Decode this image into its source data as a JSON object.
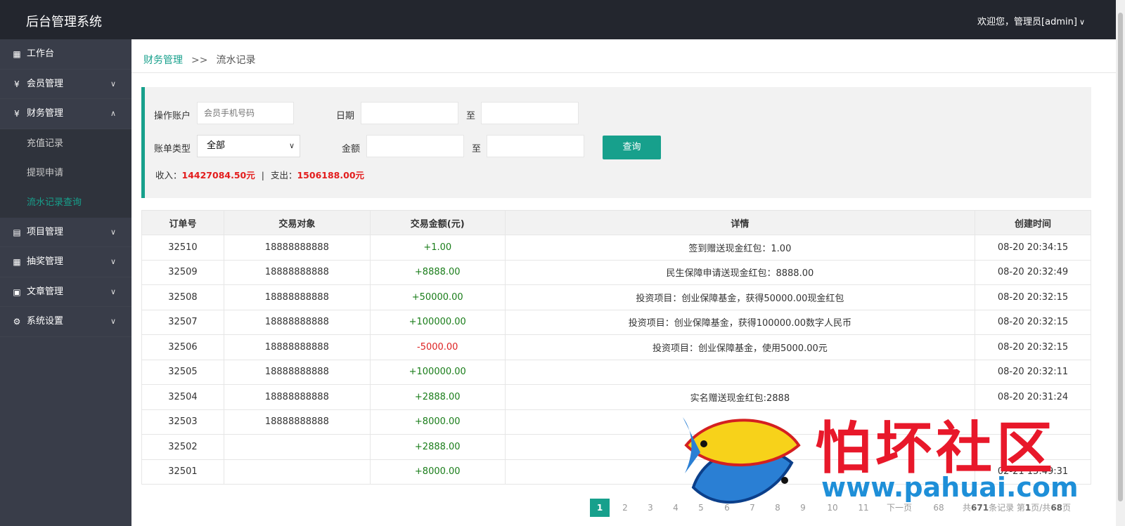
{
  "header": {
    "app_title": "后台管理系统",
    "user_greeting": "欢迎您，管理员[admin]"
  },
  "sidebar": {
    "items": [
      {
        "label": "工作台",
        "icon": "dashboard-icon",
        "expandable": false
      },
      {
        "label": "会员管理",
        "icon": "yen-circle-icon",
        "expandable": true,
        "expanded": false
      },
      {
        "label": "财务管理",
        "icon": "yen-circle-icon",
        "expandable": true,
        "expanded": true,
        "children": [
          {
            "label": "充值记录",
            "active": false
          },
          {
            "label": "提现申请",
            "active": false
          },
          {
            "label": "流水记录查询",
            "active": true
          }
        ]
      },
      {
        "label": "项目管理",
        "icon": "clipboard-icon",
        "expandable": true,
        "expanded": false
      },
      {
        "label": "抽奖管理",
        "icon": "dashboard-icon",
        "expandable": true,
        "expanded": false
      },
      {
        "label": "文章管理",
        "icon": "document-icon",
        "expandable": true,
        "expanded": false
      },
      {
        "label": "系统设置",
        "icon": "gear-icon",
        "expandable": true,
        "expanded": false
      }
    ]
  },
  "breadcrumb": {
    "parent": "财务管理",
    "separator": ">>",
    "current": "流水记录"
  },
  "filter": {
    "account_label": "操作账户",
    "account_placeholder": "会员手机号码",
    "date_label": "日期",
    "to_label": "至",
    "bill_type_label": "账单类型",
    "bill_type_value": "全部",
    "amount_label": "金额",
    "query_button": "查询",
    "income_label": "收入：",
    "income_value": "14427084.50元",
    "summary_separator": "|",
    "expense_label": "支出：",
    "expense_value": "1506188.00元"
  },
  "table": {
    "headers": [
      "订单号",
      "交易对象",
      "交易金额(元)",
      "详情",
      "创建时间"
    ],
    "rows": [
      {
        "id": "32510",
        "target": "18888888888",
        "amount": "+1.00",
        "detail": "签到赠送现金红包：1.00",
        "time": "08-20 20:34:15"
      },
      {
        "id": "32509",
        "target": "18888888888",
        "amount": "+8888.00",
        "detail": "民生保障申请送现金红包：8888.00",
        "time": "08-20 20:32:49"
      },
      {
        "id": "32508",
        "target": "18888888888",
        "amount": "+50000.00",
        "detail": "投资项目：创业保障基金，获得50000.00现金红包",
        "time": "08-20 20:32:15"
      },
      {
        "id": "32507",
        "target": "18888888888",
        "amount": "+100000.00",
        "detail": "投资项目：创业保障基金，获得100000.00数字人民币",
        "time": "08-20 20:32:15"
      },
      {
        "id": "32506",
        "target": "18888888888",
        "amount": "-5000.00",
        "detail": "投资项目：创业保障基金，使用5000.00元",
        "time": "08-20 20:32:15"
      },
      {
        "id": "32505",
        "target": "18888888888",
        "amount": "+100000.00",
        "detail": "",
        "time": "08-20 20:32:11"
      },
      {
        "id": "32504",
        "target": "18888888888",
        "amount": "+2888.00",
        "detail": "实名赠送现金红包:2888",
        "time": "08-20 20:31:24"
      },
      {
        "id": "32503",
        "target": "18888888888",
        "amount": "+8000.00",
        "detail": "",
        "time": ""
      },
      {
        "id": "32502",
        "target": "",
        "amount": "+2888.00",
        "detail": "",
        "time": ""
      },
      {
        "id": "32501",
        "target": "",
        "amount": "+8000.00",
        "detail": "",
        "time": "02-21 15:49:31"
      }
    ]
  },
  "pagination": {
    "pages": [
      "1",
      "2",
      "3",
      "4",
      "5",
      "6",
      "7",
      "8",
      "9",
      "10",
      "11"
    ],
    "current": "1",
    "next_label": "下一页",
    "last_page": "68",
    "info_prefix": "共",
    "total_records": "671",
    "info_records": "条记录 第",
    "current_page": "1",
    "info_page": "页/共",
    "total_pages": "68",
    "info_suffix": "页"
  },
  "watermark": {
    "text": "怕坏社区",
    "url": "www.pahuai.com"
  },
  "colors": {
    "accent": "#17a08c",
    "header_bg": "#23262e",
    "sidebar_bg": "#393d49",
    "income_color": "#e31d1d",
    "positive_amount": "#1a7d1a",
    "negative_amount": "#dd2222"
  }
}
